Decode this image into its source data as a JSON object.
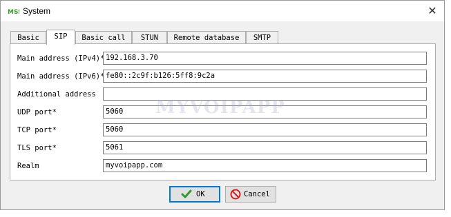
{
  "window": {
    "title": "System",
    "app_icon": "mss-logo-icon",
    "close_icon": "close-icon"
  },
  "tabs": [
    {
      "label": "Basic",
      "active": false
    },
    {
      "label": "SIP",
      "active": true
    },
    {
      "label": "Basic call",
      "active": false
    },
    {
      "label": "STUN",
      "active": false
    },
    {
      "label": "Remote database",
      "active": false
    },
    {
      "label": "SMTP",
      "active": false
    }
  ],
  "form": {
    "main_ipv4": {
      "label": "Main address (IPv4)*",
      "value": "192.168.3.70"
    },
    "main_ipv6": {
      "label": "Main address (IPv6)*",
      "value": "fe80::2c9f:b126:5ff8:9c2a"
    },
    "additional": {
      "label": "Additional address",
      "value": ""
    },
    "udp_port": {
      "label": "UDP port*",
      "value": "5060"
    },
    "tcp_port": {
      "label": "TCP port*",
      "value": "5060"
    },
    "tls_port": {
      "label": "TLS port*",
      "value": "5061"
    },
    "realm": {
      "label": "Realm",
      "value": "myvoipapp.com"
    }
  },
  "watermark": "MYVOIPAPP",
  "buttons": {
    "ok": {
      "label": "OK",
      "icon": "check-icon"
    },
    "cancel": {
      "label": "Cancel",
      "icon": "cancel-icon"
    }
  },
  "colors": {
    "ok_check": "#2e9a2e",
    "cancel_red": "#d22020",
    "focus_blue": "#0078d7"
  }
}
